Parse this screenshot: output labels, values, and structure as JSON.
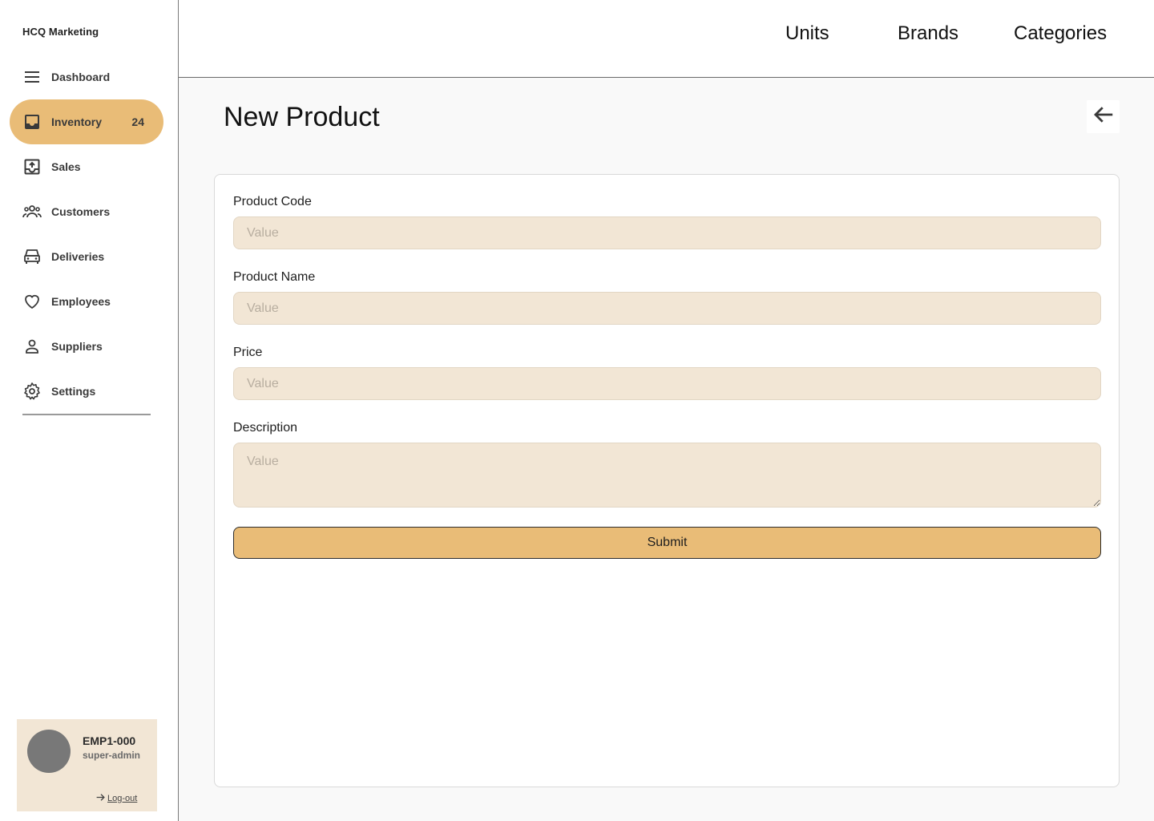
{
  "brand": "HCQ Marketing",
  "sidebar": {
    "items": [
      {
        "label": "Dashboard",
        "icon": "menu-icon"
      },
      {
        "label": "Inventory",
        "icon": "inbox-icon",
        "badge": "24",
        "active": true
      },
      {
        "label": "Sales",
        "icon": "upload-box-icon"
      },
      {
        "label": "Customers",
        "icon": "group-icon"
      },
      {
        "label": "Deliveries",
        "icon": "car-icon"
      },
      {
        "label": "Employees",
        "icon": "heart-icon"
      },
      {
        "label": "Suppliers",
        "icon": "person-icon"
      },
      {
        "label": "Settings",
        "icon": "gear-icon"
      }
    ]
  },
  "user": {
    "id": "EMP1-000",
    "role": "super-admin",
    "logout_label": "Log-out"
  },
  "topnav": {
    "units": "Units",
    "brands": "Brands",
    "categories": "Categories"
  },
  "page": {
    "title": "New Product"
  },
  "form": {
    "product_code": {
      "label": "Product Code",
      "placeholder": "Value",
      "value": ""
    },
    "product_name": {
      "label": "Product Name",
      "placeholder": "Value",
      "value": ""
    },
    "price": {
      "label": "Price",
      "placeholder": "Value",
      "value": ""
    },
    "description": {
      "label": "Description",
      "placeholder": "Value",
      "value": ""
    },
    "submit_label": "Submit"
  },
  "colors": {
    "accent": "#e9bc77",
    "input_bg": "#f2e6d5",
    "avatar": "#787878"
  }
}
